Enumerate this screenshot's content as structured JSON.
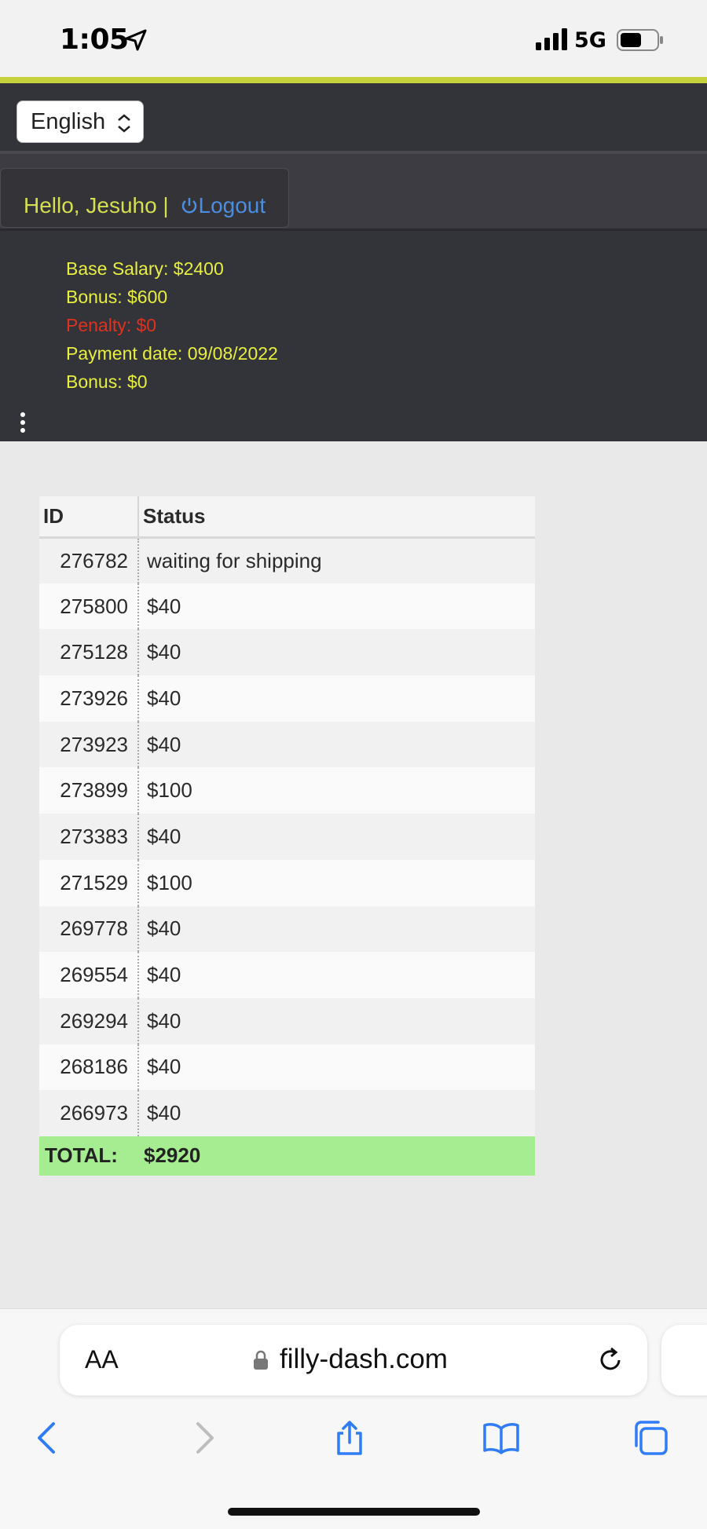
{
  "status_bar": {
    "time": "1:05",
    "network": "5G",
    "icons": [
      "location-arrow-icon",
      "signal-bars-icon",
      "battery-icon"
    ]
  },
  "header": {
    "language": "English",
    "greeting": "Hello, Jesuho | ",
    "logout_label": "Logout",
    "info": {
      "base_salary": "Base Salary: $2400",
      "bonus": "Bonus: $600",
      "penalty": "Penalty: $0",
      "payment_date": "Payment date: 09/08/2022",
      "bonus2": "Bonus: $0"
    }
  },
  "table": {
    "headers": [
      "ID",
      "Status"
    ],
    "rows": [
      {
        "id": "276782",
        "status": "waiting for shipping"
      },
      {
        "id": "275800",
        "status": "$40"
      },
      {
        "id": "275128",
        "status": "$40"
      },
      {
        "id": "273926",
        "status": "$40"
      },
      {
        "id": "273923",
        "status": "$40"
      },
      {
        "id": "273899",
        "status": "$100"
      },
      {
        "id": "273383",
        "status": "$40"
      },
      {
        "id": "271529",
        "status": "$100"
      },
      {
        "id": "269778",
        "status": "$40"
      },
      {
        "id": "269554",
        "status": "$40"
      },
      {
        "id": "269294",
        "status": "$40"
      },
      {
        "id": "268186",
        "status": "$40"
      },
      {
        "id": "266973",
        "status": "$40"
      }
    ],
    "total_label": "TOTAL:",
    "total_value": "$2920"
  },
  "browser": {
    "text_size_label": "AA",
    "domain": "filly-dash.com"
  },
  "colors": {
    "accent_line": "#c5d23c",
    "header_bg": "#33333a",
    "info_text": "#e8ef3e",
    "penalty_text": "#e0321e",
    "link": "#4b8ee0",
    "total_row": "#a6ec90"
  }
}
